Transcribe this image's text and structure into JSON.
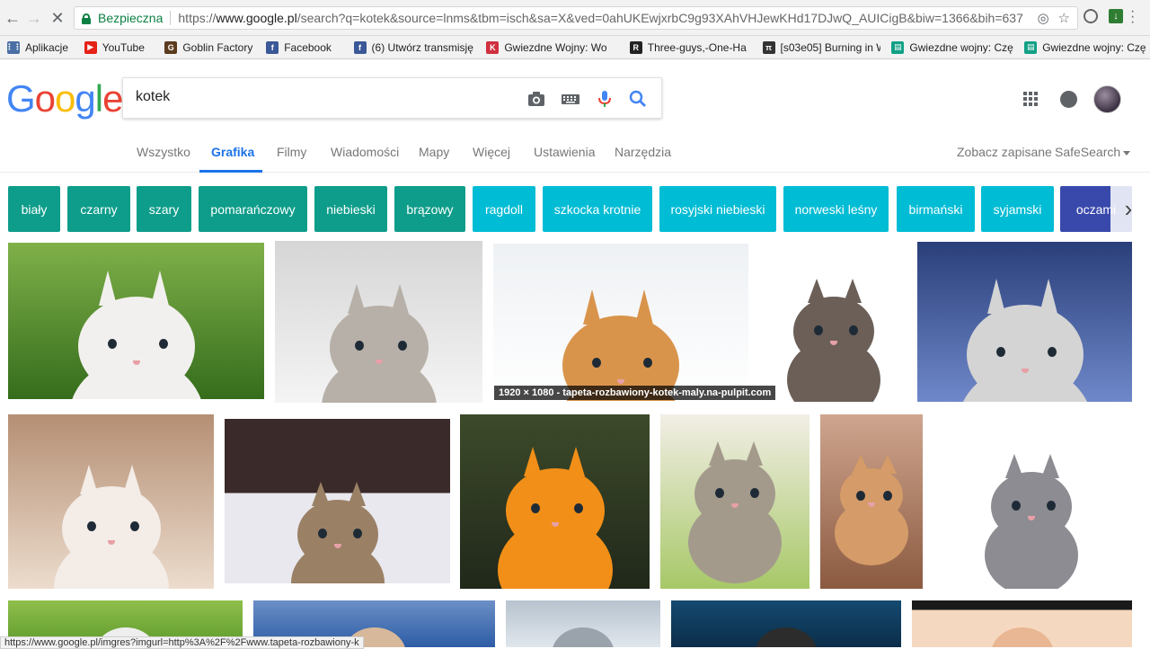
{
  "browser": {
    "secure_label": "Bezpieczna",
    "url_prefix": "https://",
    "url_host": "www.google.pl",
    "url_rest": "/search?q=kotek&source=lnms&tbm=isch&sa=X&ved=0ahUKEwjxrbC9g93XAhVHJewKHd17DJwQ_AUICigB&biw=1366&bih=637"
  },
  "bookmarks": [
    {
      "label": "Aplikacje",
      "icon": "apps-grid-icon",
      "color": "#4a6fa5"
    },
    {
      "label": "YouTube",
      "icon": "youtube-icon",
      "color": "#e62117"
    },
    {
      "label": "Goblin Factory",
      "icon": "goblin-icon",
      "color": "#5b3b1e"
    },
    {
      "label": "Facebook",
      "icon": "facebook-icon",
      "color": "#3b5998"
    },
    {
      "label": "(6) Utwórz transmisję",
      "icon": "facebook-icon",
      "color": "#3b5998"
    },
    {
      "label": "Gwiezdne Wojny: Wo",
      "icon": "k-icon",
      "color": "#d0303f"
    },
    {
      "label": "Three-guys,-One-Ha",
      "icon": "rtg-icon",
      "color": "#222222"
    },
    {
      "label": "[s03e05] Burning in W",
      "icon": "pi-icon",
      "color": "#333333"
    },
    {
      "label": "Gwiezdne wojny: Czę",
      "icon": "bookmark-icon",
      "color": "#12a086"
    },
    {
      "label": "Gwiezdne wojny: Czę",
      "icon": "bookmark-icon",
      "color": "#12a086"
    }
  ],
  "google": {
    "logo_letters": [
      {
        "char": "G",
        "color": "#4285f4"
      },
      {
        "char": "o",
        "color": "#ea4335"
      },
      {
        "char": "o",
        "color": "#fbbc05"
      },
      {
        "char": "g",
        "color": "#4285f4"
      },
      {
        "char": "l",
        "color": "#34a853"
      },
      {
        "char": "e",
        "color": "#ea4335"
      }
    ],
    "search_value": "kotek"
  },
  "tabs": {
    "all": "Wszystko",
    "images": "Grafika",
    "videos": "Filmy",
    "news": "Wiadomości",
    "maps": "Mapy",
    "more": "Więcej",
    "settings": "Ustawienia",
    "tools": "Narzędzia",
    "saved": "Zobacz zapisane",
    "safesearch": "SafeSearch"
  },
  "chips": [
    {
      "label": "biały",
      "color": "#0e9d8a"
    },
    {
      "label": "czarny",
      "color": "#0e9d8a"
    },
    {
      "label": "szary",
      "color": "#0e9d8a"
    },
    {
      "label": "pomarańczowy",
      "color": "#0e9d8a"
    },
    {
      "label": "niebieski",
      "color": "#0e9d8a"
    },
    {
      "label": "brązowy",
      "color": "#0e9d8a"
    },
    {
      "label": "ragdoll",
      "color": "#00bcd4"
    },
    {
      "label": "szkocka krotnie",
      "color": "#00bcd4"
    },
    {
      "label": "rosyjski niebieski",
      "color": "#00bcd4"
    },
    {
      "label": "norweski leśny",
      "color": "#00bcd4"
    },
    {
      "label": "birmański",
      "color": "#00bcd4"
    },
    {
      "label": "syjamski",
      "color": "#00bcd4"
    },
    {
      "label": "oczami",
      "color": "#3949ab"
    }
  ],
  "images": {
    "hover_caption": "1920 × 1080 - tapeta-rozbawiony-kotek-maly.na-pulpit.com"
  },
  "status_url": "https://www.google.pl/imgres?imgurl=http%3A%2F%2Fwww.tapeta-rozbawiony-k"
}
